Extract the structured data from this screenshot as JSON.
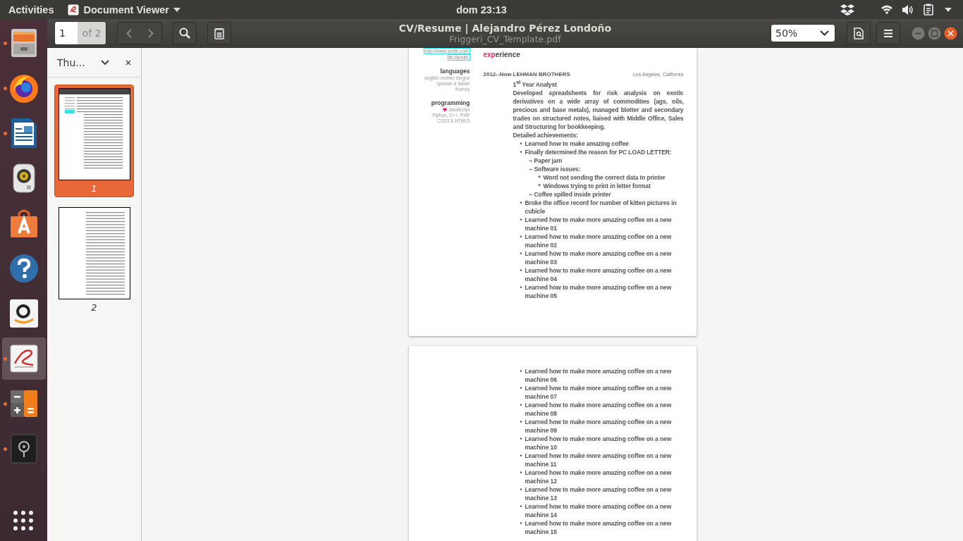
{
  "top_bar": {
    "activities": "Activities",
    "app_menu": "Document Viewer",
    "clock": "dom 23:13"
  },
  "dock": {
    "apps": [
      {
        "kind": "files",
        "running": true,
        "selected": false
      },
      {
        "kind": "browser",
        "running": true,
        "selected": false
      },
      {
        "kind": "writer",
        "running": true,
        "selected": false
      },
      {
        "kind": "music",
        "running": false,
        "selected": false
      },
      {
        "kind": "store",
        "running": false,
        "selected": false
      },
      {
        "kind": "help",
        "running": false,
        "selected": false
      },
      {
        "kind": "shop",
        "running": false,
        "selected": false
      },
      {
        "kind": "viewer",
        "running": true,
        "selected": true
      },
      {
        "kind": "calculator",
        "running": true,
        "selected": false
      },
      {
        "kind": "camera",
        "running": true,
        "selected": false
      }
    ]
  },
  "toolbar": {
    "page_number": "1",
    "page_count": "of 2",
    "title": "CV/Resume | Alejandro Pérez Londoño",
    "subtitle": "Friggeri_CV_Template.pdf",
    "zoom": "50%"
  },
  "sidebar": {
    "title": "Thu...",
    "thumbnails": [
      {
        "label": "1",
        "selected": true
      },
      {
        "label": "2",
        "selected": false
      }
    ]
  },
  "page_1": {
    "links": [
      "http://www.smith.com",
      "fb://jsmith"
    ],
    "sections": [
      {
        "heading": "languages",
        "lines": [
          {
            "kind": "plain",
            "text": "english mother tongue"
          },
          {
            "kind": "plain",
            "text": "spanish & italian"
          },
          {
            "kind": "plain",
            "text": "fluency"
          }
        ]
      },
      {
        "heading": "programming",
        "lines": [
          {
            "kind": "favorite",
            "text": "JavaScript"
          },
          {
            "kind": "plain",
            "text": "Python, C++, PHP"
          },
          {
            "kind": "plain",
            "text": "CSS3 & HTML5"
          }
        ]
      }
    ],
    "heading": {
      "accent": "exp",
      "rest": "erience"
    },
    "entry": {
      "date": "2012--Now",
      "company": "LEHMAN BROTHERS",
      "location": "Los Angeles, California",
      "role": "1$^{st}$ Year Analyst",
      "description": "Developed spreadsheets for risk analysis on exotic derivatives on a wide array of commodities (ags, oils, precious and base metals), managed blotter and secondary trades on structured notes, liaised with Middle Office, Sales and Structuring for bookkeeping.",
      "achievements_label": "Detailed achievements:",
      "items": [
        {
          "marker": "•",
          "text": "Learned how to make amazing coffee"
        },
        {
          "marker": "•",
          "text": "Finally determined the reason for PC LOAD LETTER:",
          "children": [
            {
              "marker": "–",
              "text": "Paper jam"
            },
            {
              "marker": "–",
              "text": "Software issues:",
              "children": [
                {
                  "marker": "*",
                  "text": "Word not sending the correct data to printer"
                },
                {
                  "marker": "*",
                  "text": "Windows trying to print in letter format"
                }
              ]
            },
            {
              "marker": "–",
              "text": "Coffee spilled inside printer"
            }
          ]
        },
        {
          "marker": "•",
          "text": "Broke the office record for number of kitten pictures in cubicle"
        },
        {
          "marker": "•",
          "text": "Learned how to make more amazing coffee on a new machine 01"
        },
        {
          "marker": "•",
          "text": "Learned how to make more amazing coffee on a new machine 02"
        },
        {
          "marker": "•",
          "text": "Learned how to make more amazing coffee on a new machine 03"
        },
        {
          "marker": "•",
          "text": "Learned how to make more amazing coffee on a new machine 04"
        },
        {
          "marker": "•",
          "text": "Learned how to make more amazing coffee on a new machine 05"
        }
      ]
    }
  },
  "page_2": {
    "items": [
      {
        "marker": "•",
        "text": "Learned how to make more amazing coffee on a new machine 06"
      },
      {
        "marker": "•",
        "text": "Learned how to make more amazing coffee on a new machine 07"
      },
      {
        "marker": "•",
        "text": "Learned how to make more amazing coffee on a new machine 08"
      },
      {
        "marker": "•",
        "text": "Learned how to make more amazing coffee on a new machine 09"
      },
      {
        "marker": "•",
        "text": "Learned how to make more amazing coffee on a new machine 10"
      },
      {
        "marker": "•",
        "text": "Learned how to make more amazing coffee on a new machine 11"
      },
      {
        "marker": "•",
        "text": "Learned how to make more amazing coffee on a new machine 12"
      },
      {
        "marker": "•",
        "text": "Learned how to make more amazing coffee on a new machine 13"
      },
      {
        "marker": "•",
        "text": "Learned how to make more amazing coffee on a new machine 14"
      },
      {
        "marker": "•",
        "text": "Learned how to make more amazing coffee on a new machine 15"
      }
    ]
  }
}
